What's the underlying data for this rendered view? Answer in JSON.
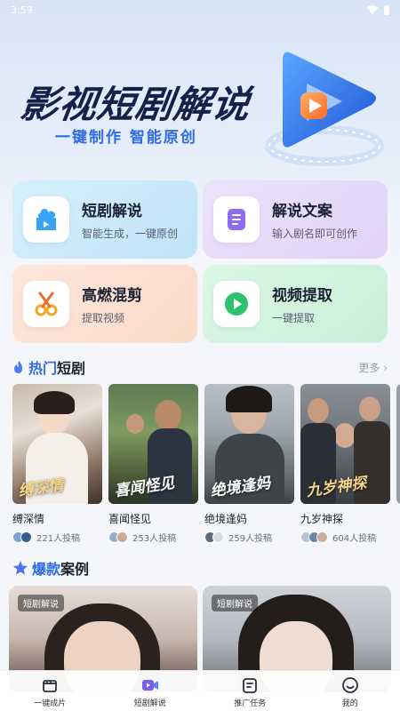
{
  "status_bar": {
    "time": "3:59"
  },
  "hero": {
    "title": "影视短剧解说",
    "subtitle": "一键制作 智能原创"
  },
  "features": [
    {
      "title": "短剧解说",
      "subtitle": "智能生成，一键原创",
      "icon": "camera-icon"
    },
    {
      "title": "解说文案",
      "subtitle": "输入剧名即可创作",
      "icon": "document-icon"
    },
    {
      "title": "高燃混剪",
      "subtitle": "提取视频",
      "icon": "scissors-icon"
    },
    {
      "title": "视频提取",
      "subtitle": "一键提取",
      "icon": "play-icon"
    }
  ],
  "hot_section": {
    "title_accent": "热门",
    "title_rest": "短剧",
    "more": "更多"
  },
  "dramas": [
    {
      "name": "缚深情",
      "count": "221人投稿",
      "caption": "缚深情"
    },
    {
      "name": "喜闻怪见",
      "count": "253人投稿",
      "caption": "喜闻怪见"
    },
    {
      "name": "绝境逢妈",
      "count": "259人投稿",
      "caption": "绝境逢妈"
    },
    {
      "name": "九岁神探",
      "count": "604人投稿",
      "caption": "九岁神探"
    }
  ],
  "case_section": {
    "title_accent": "爆款",
    "title_rest": "案例"
  },
  "cases": [
    {
      "badge": "短剧解说"
    },
    {
      "badge": "短剧解说"
    }
  ],
  "bottom_nav": [
    {
      "label": "一键成片",
      "icon": "clapperboard-icon"
    },
    {
      "label": "短剧解说",
      "icon": "video-camera-icon"
    },
    {
      "label": "推广任务",
      "icon": "task-icon"
    },
    {
      "label": "我的",
      "icon": "smile-icon"
    }
  ],
  "colors": {
    "accent": "#2f6bea",
    "title": "#14214a"
  }
}
